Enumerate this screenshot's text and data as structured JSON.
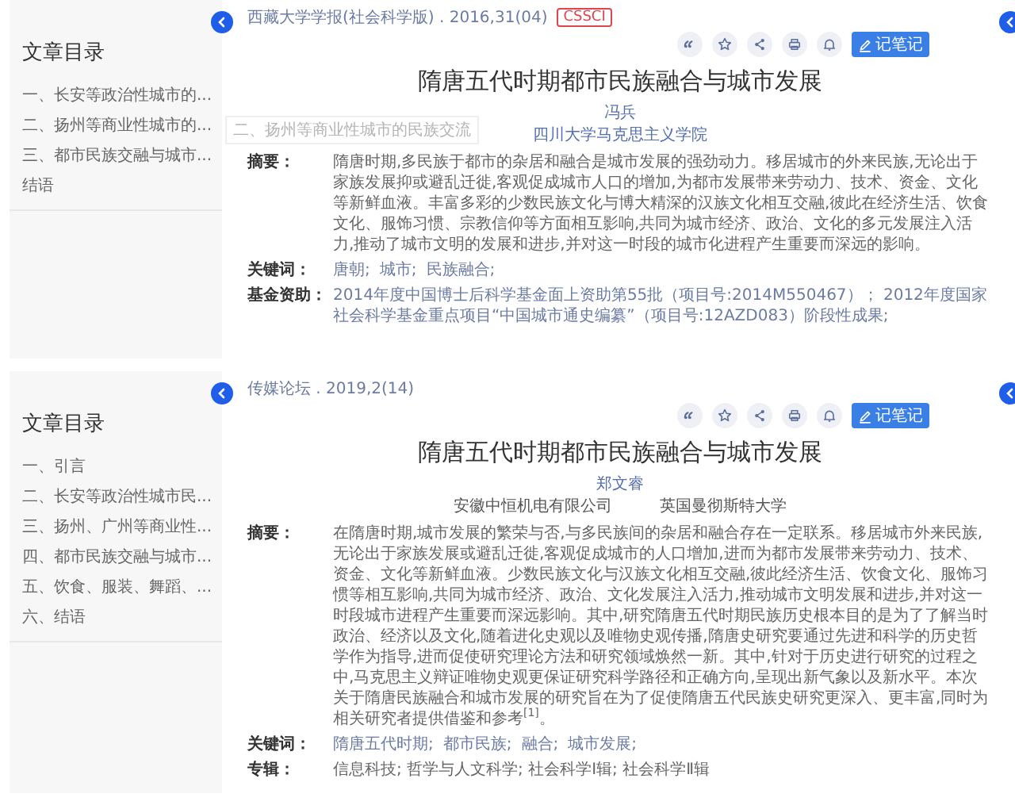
{
  "panels": [
    {
      "sidebar": {
        "title": "文章目录",
        "items": [
          {
            "label": "一、长安等政治性城市的..."
          },
          {
            "label": "二、扬州等商业性城市的..."
          },
          {
            "label": "三、都市民族交融与城市..."
          },
          {
            "label": "结语"
          }
        ]
      },
      "tooltip": "二、扬州等商业性城市的民族交流",
      "source": {
        "journal": "西藏大学学报(社会科学版) . 2016,31(04)",
        "badge": "CSSCI"
      },
      "note_button": "记笔记",
      "title": "隋唐五代时期都市民族融合与城市发展",
      "authors": [
        "冯兵"
      ],
      "affiliations": [
        "四川大学马克思主义学院"
      ],
      "fields": [
        {
          "kind": "text",
          "label": "摘要：",
          "text": "隋唐时期,多民族于都市的杂居和融合是城市发展的强劲动力。移居城市的外来民族,无论出于家族发展抑或避乱迁徙,客观促成城市人口的增加,为都市发展带来劳动力、技术、资金、文化等新鲜血液。丰富多彩的少数民族文化与博大精深的汉族文化相互交融,彼此在经济生活、饮食文化、服饰习惯、宗教信仰等方面相互影响,共同为城市经济、政治、文化的多元发展注入活力,推动了城市文明的发展和进步,并对这一时段的城市化进程产生重要而深远的影响。"
        },
        {
          "kind": "terms",
          "label": "关键词：",
          "terms": [
            "唐朝;",
            "城市;",
            "民族融合;"
          ]
        },
        {
          "kind": "link",
          "label": "基金资助：",
          "text": "2014年度中国博士后科学基金面上资助第55批（项目号:2014M550467）； 2012年度国家社会科学基金重点项目“中国城市通史编纂”（项目号:12AZD083）阶段性成果;"
        }
      ]
    },
    {
      "sidebar": {
        "title": "文章目录",
        "items": [
          {
            "label": "一、引言"
          },
          {
            "label": "二、长安等政治性城市民..."
          },
          {
            "label": "三、扬州、广州等商业性..."
          },
          {
            "label": "四、都市民族交融与城市..."
          },
          {
            "label": "五、饮食、服装、舞蹈、..."
          },
          {
            "label": "六、结语"
          }
        ]
      },
      "source": {
        "journal": "传媒论坛 . 2019,2(14)"
      },
      "note_button": "记笔记",
      "title": "隋唐五代时期都市民族融合与城市发展",
      "authors": [
        "郑文睿"
      ],
      "affiliations": [
        "安徽中恒机电有限公司",
        "英国曼彻斯特大学"
      ],
      "fields": [
        {
          "kind": "text",
          "label": "摘要：",
          "text": "在隋唐时期,城市发展的繁荣与否,与多民族间的杂居和融合存在一定联系。移居城市外来民族,无论出于家族发展或避乱迁徙,客观促成城市的人口增加,进而为都市发展带来劳动力、技术、资金、文化等新鲜血液。少数民族文化与汉族文化相互交融,彼此经济生活、饮食文化、服饰习惯等相互影响,共同为城市经济、政治、文化发展注入活力,推动城市文明发展和进步,并对这一时段城市进程产生重要而深远影响。其中,研究隋唐五代时期民族历史根本目的是为了了解当时政治、经济以及文化,随着进化史观以及唯物史观传播,隋唐史研究要通过先进和科学的历史哲学作为指导,进而促使研究理论方法和研究领域焕然一新。其中,针对于历史进行研究的过程之中,马克思主义辩证唯物史观更保证研究科学路径和正确方向,呈现出新气象以及新水平。本次关于隋唐民族融合和城市发展的研究旨在为了促使隋唐五代民族史研究更深入、更丰富,同时为相关研究者提供借鉴和参考$^{[1]}$。"
        },
        {
          "kind": "terms",
          "label": "关键词：",
          "terms": [
            "隋唐五代时期;",
            "都市民族;",
            "融合;",
            "城市发展;"
          ]
        },
        {
          "kind": "text",
          "label": "专辑：",
          "text": "信息科技; 哲学与人文科学; 社会科学Ⅰ辑; 社会科学Ⅱ辑"
        }
      ]
    }
  ]
}
